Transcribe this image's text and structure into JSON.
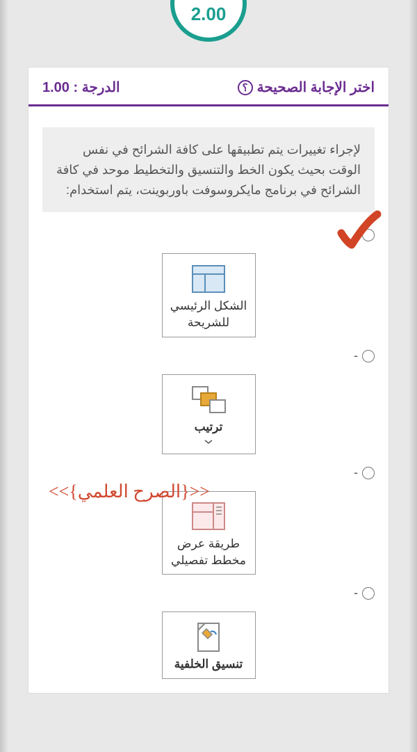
{
  "score": "2.00",
  "header": {
    "title": "اختر الإجابة الصحيحة",
    "grade_label": "الدرجة :",
    "grade_value": "1.00"
  },
  "question": "لإجراء تغييرات يتم تطبيقها على كافة الشرائح في نفس الوقت بحيث يكون الخط والتنسيق والتخطيط موحد في كافة الشرائح في برنامج مايكروسوفت باوربوينت، يتم استخدام:",
  "options": [
    {
      "label": "الشكل الرئيسي للشريحة"
    },
    {
      "label": "ترتيب"
    },
    {
      "label": "طريقة عرض مخطط تفصيلي"
    },
    {
      "label": "تنسيق الخلفية"
    }
  ],
  "dash": "-",
  "watermark": "<<{الصرح العلمي}>>"
}
